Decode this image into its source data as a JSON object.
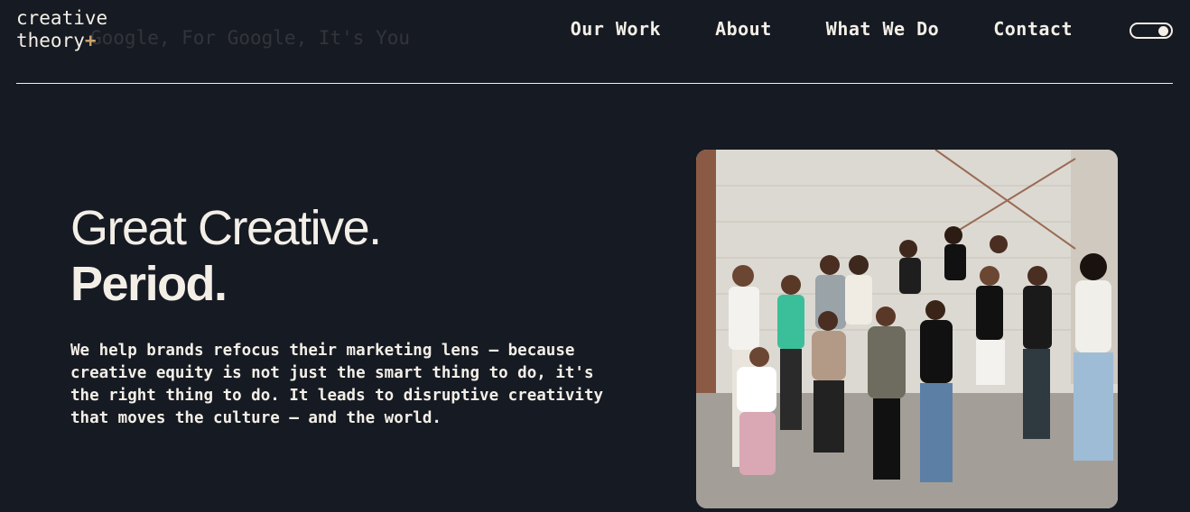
{
  "header": {
    "logo_line1": "creative",
    "logo_line2": "theory",
    "logo_mark": "+",
    "ghost_text": "Google, For Google, It's You"
  },
  "nav": {
    "items": [
      {
        "label": "Our Work"
      },
      {
        "label": "About"
      },
      {
        "label": "What We Do"
      },
      {
        "label": "Contact"
      }
    ],
    "theme_toggle_icon": "toggle-switch-icon"
  },
  "hero": {
    "headline_line1": "Great Creative.",
    "headline_line2": "Period.",
    "body": "We help brands refocus their marketing lens — because creative equity is not just the smart thing to do, it's the right thing to do. It leads to disruptive creativity that moves the culture — and the world."
  },
  "colors": {
    "background": "#161a22",
    "text": "#f3efe7",
    "accent": "#c9a06a"
  }
}
